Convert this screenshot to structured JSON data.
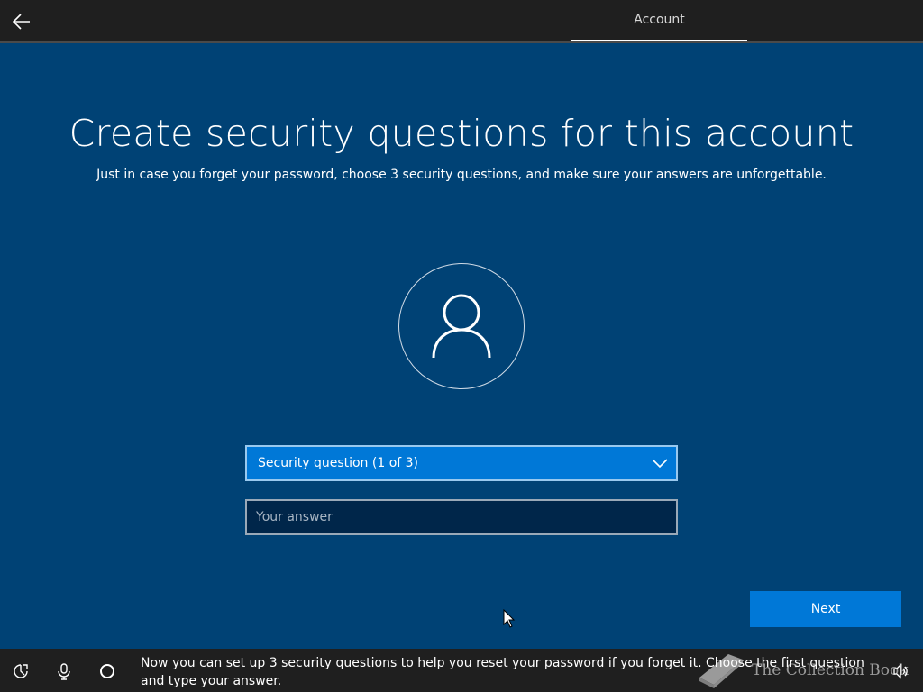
{
  "header": {
    "tab_label": "Account",
    "back_icon": "back-arrow-icon"
  },
  "main": {
    "title": "Create security questions for this account",
    "subtitle": "Just in case you forget your password, choose 3 security questions, and make sure your answers are unforgettable.",
    "avatar_icon": "user-icon",
    "question_dropdown": {
      "selected": "Security question (1 of 3)"
    },
    "answer_field": {
      "value": "",
      "placeholder": "Your answer"
    },
    "next_label": "Next"
  },
  "footer": {
    "icons": [
      "ease-of-access-icon",
      "microphone-icon",
      "cortana-icon",
      "volume-icon"
    ],
    "narration": "Now you can set up 3 security questions to help you reset your password if you forget it. Choose the first question and type your answer.",
    "watermark_text": "The Collection Book"
  },
  "colors": {
    "background": "#004275",
    "accent": "#0078d7",
    "bar": "#1f1f1f",
    "input_bg": "#00264a"
  }
}
